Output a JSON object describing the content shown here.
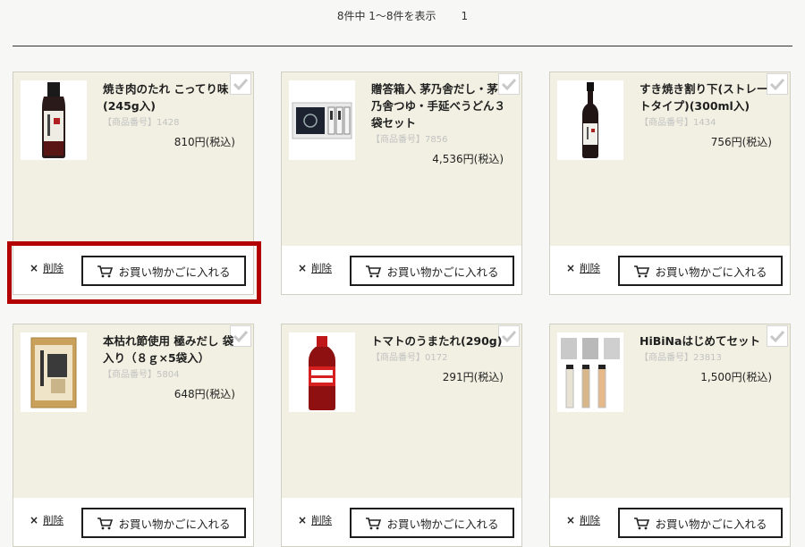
{
  "pager": {
    "count_text": "8件中 1〜8件を表示",
    "page": "1"
  },
  "colors": {
    "highlight": "#b30000",
    "card_bg": "#f1f0e2"
  },
  "icons": {
    "check": "check-icon",
    "cart": "cart-icon"
  },
  "cards": [
    {
      "name": "焼き肉のたれ こってり味(245g入)",
      "code": "【商品番号】1428",
      "price": "810円(税込)",
      "delete_label": "削除",
      "cart_label": "お買い物かごに入れる"
    },
    {
      "name": "贈答箱入 茅乃舎だし・茅乃舎つゆ・手延べうどん３袋セット",
      "code": "【商品番号】7856",
      "price": "4,536円(税込)",
      "delete_label": "削除",
      "cart_label": "お買い物かごに入れる"
    },
    {
      "name": "すき焼き割り下(ストレートタイプ)(300ml入)",
      "code": "【商品番号】1434",
      "price": "756円(税込)",
      "delete_label": "削除",
      "cart_label": "お買い物かごに入れる"
    },
    {
      "name": "本枯れ節使用 極みだし 袋入り（８ｇ×5袋入）",
      "code": "【商品番号】5804",
      "price": "648円(税込)",
      "delete_label": "削除",
      "cart_label": "お買い物かごに入れる"
    },
    {
      "name": "トマトのうまたれ(290g)",
      "code": "【商品番号】0172",
      "price": "291円(税込)",
      "delete_label": "削除",
      "cart_label": "お買い物かごに入れる"
    },
    {
      "name": "HiBiNaはじめてセット",
      "code": "【商品番号】23813",
      "price": "1,500円(税込)",
      "delete_label": "削除",
      "cart_label": "お買い物かごに入れる"
    }
  ]
}
